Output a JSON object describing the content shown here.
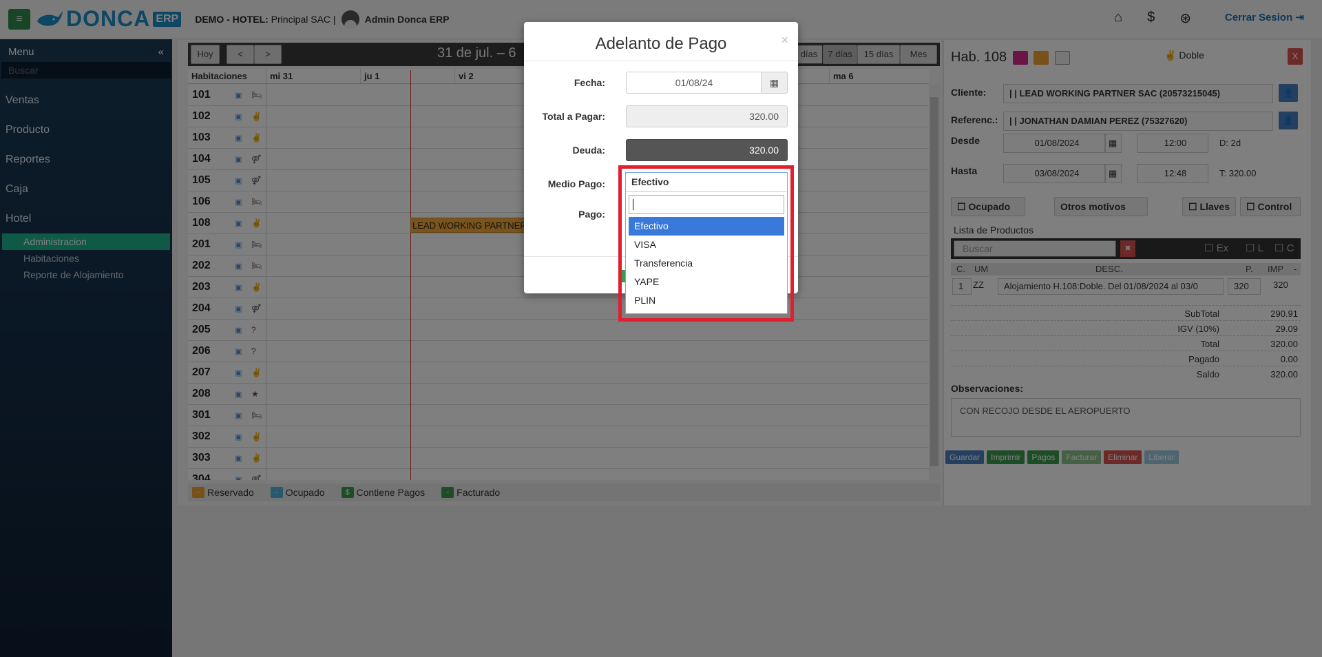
{
  "header": {
    "app_name": "DONCA",
    "app_suffix": "ERP",
    "company_prefix": "DEMO - HOTEL:",
    "company_name": "Principal SAC |",
    "user": "Admin Donca ERP",
    "logout": "Cerrar Sesion"
  },
  "sidebar": {
    "menu_title": "Menu",
    "collapse_icon": "«",
    "search_placeholder": "Buscar",
    "items": [
      "Ventas",
      "Producto",
      "Reportes",
      "Caja",
      "Hotel"
    ],
    "subitems": [
      "Administracion",
      "Habitaciones",
      "Reporte de Alojamiento"
    ]
  },
  "calendar": {
    "today": "Hoy",
    "prev": "<",
    "next": ">",
    "range": "31 de jul. – 6",
    "views": [
      "días",
      "7 días",
      "15 días",
      "Mes"
    ],
    "columns": [
      "Habitaciones",
      "mi 31",
      "ju 1",
      "vi 2",
      "ma 6"
    ],
    "rooms": [
      {
        "num": "101",
        "icon": "🛏"
      },
      {
        "num": "102",
        "icon": "✌"
      },
      {
        "num": "103",
        "icon": "✌"
      },
      {
        "num": "104",
        "icon": "⚤"
      },
      {
        "num": "105",
        "icon": "⚤"
      },
      {
        "num": "106",
        "icon": "🛏"
      },
      {
        "num": "108",
        "icon": "✌"
      },
      {
        "num": "201",
        "icon": "🛏"
      },
      {
        "num": "202",
        "icon": "🛏"
      },
      {
        "num": "203",
        "icon": "✌"
      },
      {
        "num": "204",
        "icon": "⚤"
      },
      {
        "num": "205",
        "icon": "?"
      },
      {
        "num": "206",
        "icon": "?"
      },
      {
        "num": "207",
        "icon": "✌"
      },
      {
        "num": "208",
        "icon": "★"
      },
      {
        "num": "301",
        "icon": "🛏"
      },
      {
        "num": "302",
        "icon": "✌"
      },
      {
        "num": "303",
        "icon": "✌"
      },
      {
        "num": "304",
        "icon": "⚤"
      }
    ],
    "booking_label": "LEAD WORKING PARTNER",
    "legend": [
      {
        "label": "Reservado",
        "color": "#f0a030",
        "mark": "-"
      },
      {
        "label": "Ocupado",
        "color": "#4ab6d8",
        "mark": "-"
      },
      {
        "label": "Contiene Pagos",
        "color": "#3b9b4d",
        "mark": "$"
      },
      {
        "label": "Facturado",
        "color": "#3b9b4d",
        "mark": "-"
      }
    ]
  },
  "panel": {
    "title": "Hab. 108",
    "type": "Doble",
    "close": "X",
    "cliente_label": "Cliente:",
    "cliente": "| | LEAD WORKING PARTNER SAC (20573215045)",
    "referenc_label": "Referenc.:",
    "referenc": "| | JONATHAN DAMIAN PEREZ (75327620)",
    "desde_label": "Desde",
    "desde_date": "01/08/2024",
    "desde_time": "12:00",
    "duration": "D: 2d",
    "hasta_label": "Hasta",
    "hasta_date": "03/08/2024",
    "hasta_time": "12:48",
    "total_short": "T: 320.00",
    "ocupado": "Ocupado",
    "otros": "Otros motivos",
    "llaves": "Llaves",
    "control": "Control",
    "productos_label": "Lista de Productos",
    "buscar": "Buscar",
    "ex": "Ex",
    "l": "L",
    "c": "C",
    "cols": {
      "c": "C.",
      "um": "UM",
      "desc": "DESC.",
      "p": "P.",
      "imp": "IMP",
      "dash": "-"
    },
    "line": {
      "qty": "1",
      "um": "ZZ",
      "desc": "Alojamiento H.108:Doble. Del 01/08/2024 al 03/0",
      "price": "320",
      "imp": "320"
    },
    "totals": [
      {
        "label": "SubTotal",
        "value": "290.91"
      },
      {
        "label": "IGV (10%)",
        "value": "29.09"
      },
      {
        "label": "Total",
        "value": "320.00"
      },
      {
        "label": "Pagado",
        "value": "0.00"
      },
      {
        "label": "Saldo",
        "value": "320.00"
      }
    ],
    "obs_label": "Observaciones:",
    "obs": "CON RECOJO DESDE EL AEROPUERTO",
    "actions": [
      {
        "label": "Guardar",
        "color": "#4a7fc0"
      },
      {
        "label": "Imprimir",
        "color": "#3b9b4d"
      },
      {
        "label": "Pagos",
        "color": "#3b9b4d"
      },
      {
        "label": "Facturar",
        "color": "#8cc08a"
      },
      {
        "label": "Eliminar",
        "color": "#d9534f"
      },
      {
        "label": "Liberar",
        "color": "#9ccbe0"
      }
    ]
  },
  "modal": {
    "title": "Adelanto de Pago",
    "close": "×",
    "fecha_label": "Fecha:",
    "fecha": "01/08/24",
    "total_label": "Total a Pagar:",
    "total": "320.00",
    "deuda_label": "Deuda:",
    "deuda": "320.00",
    "medio_label": "Medio Pago:",
    "pago_label": "Pago:"
  },
  "dropdown": {
    "selected": "Efectivo",
    "options": [
      "Efectivo",
      "VISA",
      "Transferencia",
      "YAPE",
      "PLIN"
    ]
  }
}
